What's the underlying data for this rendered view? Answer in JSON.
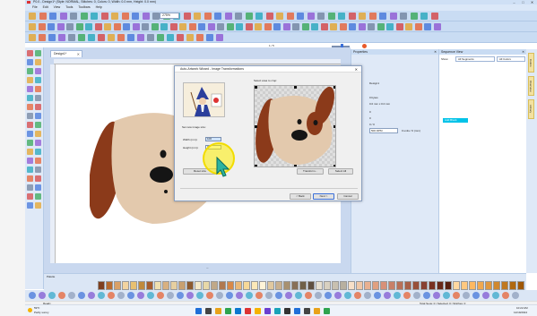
{
  "window": {
    "title": "P0.0 - Design1* (Style: NORMAL, Stitches: 0, Colors: 0, Width: 0.0 mm, Height: 0.0 mm)",
    "minimize": "–",
    "maximize": "□",
    "close": "✕"
  },
  "menu": {
    "items": [
      "File",
      "Edit",
      "View",
      "Tools",
      "Toolbars",
      "Help"
    ]
  },
  "toolbar": {
    "zoom_value": "275%",
    "page_indicator": "1 / 5"
  },
  "document": {
    "tab_label": "Design1*",
    "tab_close": "✕"
  },
  "properties_panel": {
    "title": "Properties",
    "close": "✕",
    "rows": [
      {
        "label": "",
        "value": "Design1"
      },
      {
        "label": "",
        "value": "0 bytes"
      },
      {
        "label": "",
        "value": "0.0 mm x 0.0 mm"
      },
      {
        "label": "",
        "value": "0"
      },
      {
        "label": "",
        "value": "0"
      },
      {
        "label": "",
        "value": "0 / 0"
      }
    ],
    "unit_select": "500 DPM",
    "size_text": "0 units / 0 (mm)"
  },
  "sequence_panel": {
    "title": "Sequence View",
    "close": "✕",
    "show_label": "Show",
    "filter_segments": "All Segments",
    "filter_colors": "All Colors",
    "selected_item": "Add Block"
  },
  "side_tabs": [
    "Colors",
    "Overview",
    "Library"
  ],
  "palette": {
    "label": "Palette",
    "colors": [
      "#7f3f1f",
      "#b86a2e",
      "#d9a066",
      "#f2d3a0",
      "#e8c070",
      "#c08a3c",
      "#a65c2e",
      "#f0e0b0",
      "#d8b080",
      "#e6cfa0",
      "#c8a070",
      "#8c5a30",
      "#f4e8c8",
      "#e8d8a8",
      "#c0a888",
      "#b07850",
      "#d88848",
      "#eab878",
      "#f6d898",
      "#fce8b8",
      "#fff4d8",
      "#e0c8a0",
      "#c8b090",
      "#a89070",
      "#887058",
      "#706048",
      "#605040",
      "#e8e0d0",
      "#d8d0c0",
      "#c8c0b0",
      "#b8b0a0",
      "#f8e0c8",
      "#f0c8a8",
      "#e8b090",
      "#e0a080",
      "#d89078",
      "#c88068",
      "#b87058",
      "#a86048",
      "#985038",
      "#884030",
      "#783020",
      "#682818",
      "#582010",
      "#ffd8a0",
      "#ffc880",
      "#ffb860",
      "#f0a850",
      "#e09840",
      "#d08830",
      "#c07820",
      "#b06810",
      "#a05808"
    ]
  },
  "status": {
    "text": "Ready",
    "right": "Total Segs: 0 | Selected: 0 | Stitches: 0"
  },
  "dialog": {
    "title": "Auto-Artwork Wizard - Image Transformations",
    "close": "✕",
    "crop_label": "Select area to crop:",
    "size_label": "Set new image size:",
    "width_label": "Width (mm):",
    "width_value": "106",
    "height_label": "Height (mm):",
    "height_value": "97",
    "reset_button": "Reset size",
    "transform_button": "Transform...",
    "select_all_button": "Select All",
    "back_button": "< Back",
    "next_button": "Next >",
    "cancel_button": "Cancel"
  },
  "taskbar": {
    "weather_temp": "59°F",
    "weather_desc": "Partly sunny",
    "time": "10:22 AM",
    "date": "12/19/2024"
  },
  "colors": {
    "ear": "#8b3a1a",
    "face": "#e3c9ad",
    "nose": "#151515",
    "accent": "#00c3e8",
    "highlight": "#f2dc00"
  }
}
